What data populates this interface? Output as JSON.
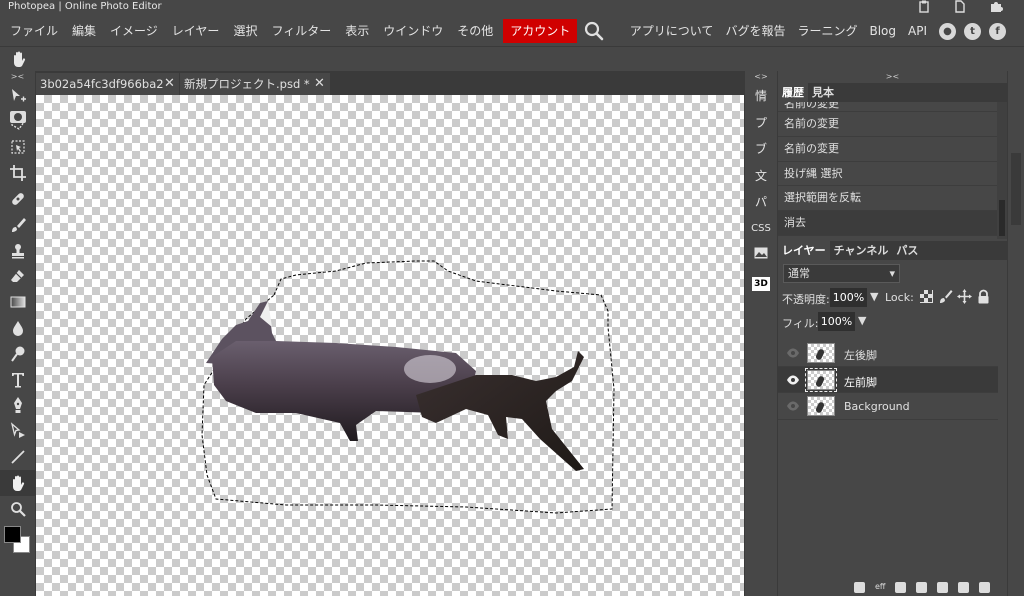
{
  "app": {
    "title": "Photopea | Online Photo Editor"
  },
  "menu": {
    "items": [
      "ファイル",
      "編集",
      "イメージ",
      "レイヤー",
      "選択",
      "フィルター",
      "表示",
      "ウインドウ",
      "その他"
    ],
    "account": "アカウント",
    "right_items": [
      "アプリについて",
      "バグを報告",
      "ラーニング",
      "Blog",
      "API"
    ],
    "social_icons": [
      "reddit-icon",
      "twitter-icon",
      "facebook-icon"
    ]
  },
  "doc_tabs": [
    {
      "label": "3b02a54fc3df966ba2"
    },
    {
      "label": "新規プロジェクト.psd *"
    }
  ],
  "mini_panel": {
    "items": [
      "情",
      "プ",
      "ブ",
      "文",
      "パ",
      "CSS",
      "",
      "3D"
    ]
  },
  "history_panel": {
    "tabs": [
      "履歴",
      "見本"
    ],
    "items": [
      "名前の変更",
      "名前の変更",
      "名前の変更",
      "投げ縄 選択",
      "選択範囲を反転",
      "消去"
    ]
  },
  "layers_panel": {
    "tabs": [
      "レイヤー",
      "チャンネル",
      "パス"
    ],
    "blend_mode": "通常",
    "opacity_label": "不透明度:",
    "opacity_value": "100%",
    "lock_label": "Lock:",
    "fill_label": "フィル:",
    "fill_value": "100%",
    "layers": [
      {
        "name": "左後脚",
        "visible": false,
        "active": false
      },
      {
        "name": "左前脚",
        "visible": true,
        "active": true
      },
      {
        "name": "Background",
        "visible": false,
        "active": false
      }
    ],
    "footer_text": "eff"
  },
  "colors": {
    "foreground": "#000000",
    "background": "#ffffff",
    "account_red": "#d00000",
    "ui_gray": "#474747"
  }
}
